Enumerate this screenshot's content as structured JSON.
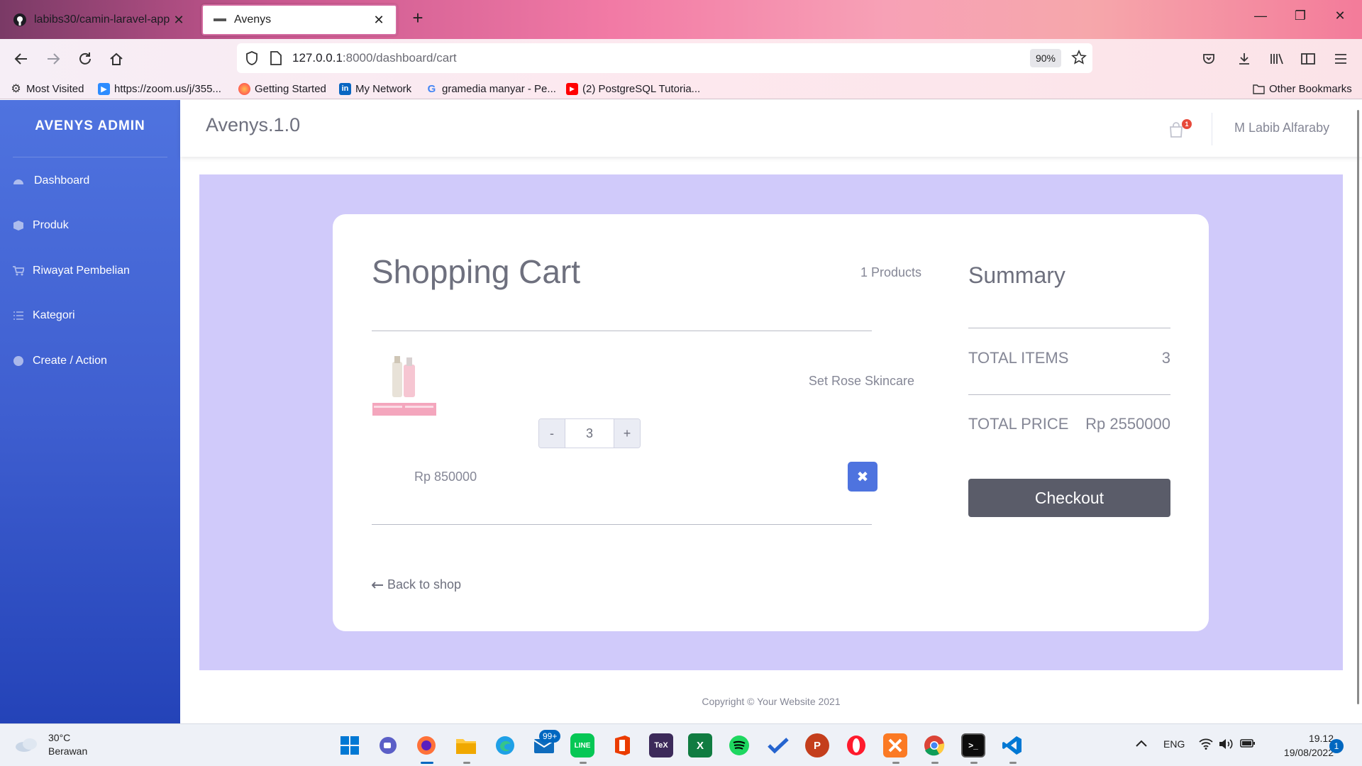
{
  "browser": {
    "tabs": [
      {
        "title": "labibs30/camin-laravel-app",
        "icon": "github-icon"
      },
      {
        "title": "Avenys",
        "icon": "site-favicon"
      }
    ],
    "url_host": "127.0.0.1",
    "url_rest": ":8000/dashboard/cart",
    "zoom": "90%",
    "bookmarks": [
      {
        "label": "Most Visited",
        "icon": "gear-icon"
      },
      {
        "label": "https://zoom.us/j/355...",
        "icon": "zoom-icon"
      },
      {
        "label": "Getting Started",
        "icon": "firefox-icon"
      },
      {
        "label": "My Network",
        "icon": "linkedin-icon"
      },
      {
        "label": "gramedia manyar - Pe...",
        "icon": "google-icon"
      },
      {
        "label": "(2) PostgreSQL Tutoria...",
        "icon": "youtube-icon"
      }
    ],
    "other_bookmarks": "Other Bookmarks"
  },
  "sidebar": {
    "brand": "AVENYS ADMIN",
    "items": [
      {
        "label": "Dashboard",
        "icon": "tachometer-icon"
      },
      {
        "label": "Produk",
        "icon": "box-icon"
      },
      {
        "label": "Riwayat Pembelian",
        "icon": "cart-icon"
      },
      {
        "label": "Kategori",
        "icon": "list-icon"
      },
      {
        "label": "Create / Action",
        "icon": "plus-circle-icon"
      }
    ]
  },
  "topbar": {
    "title": "Avenys.1.0",
    "cart_badge": "1",
    "user": "M Labib Alfaraby"
  },
  "cart": {
    "title": "Shopping Cart",
    "count": "1 Products",
    "item": {
      "name": "Set Rose Skincare",
      "quantity": "3",
      "price": "Rp 850000",
      "minus": "-",
      "plus": "+",
      "remove": "✖"
    },
    "back": "Back to shop"
  },
  "summary": {
    "title": "Summary",
    "total_items_label": "TOTAL ITEMS",
    "total_items_value": "3",
    "total_price_label": "TOTAL PRICE",
    "total_price_value": "Rp 2550000",
    "checkout": "Checkout"
  },
  "footer": {
    "copyright": "Copyright © Your Website 2021"
  },
  "taskbar": {
    "temperature": "30°C",
    "weather": "Berawan",
    "mail_badge": "99+",
    "language": "ENG",
    "time": "19.12",
    "date": "19/08/2022",
    "notifications": "1"
  },
  "colors": {
    "sidebar": "#4e73df",
    "content_bg": "#d0cafa",
    "checkout": "#5a5c69",
    "remove": "#4e73df"
  }
}
